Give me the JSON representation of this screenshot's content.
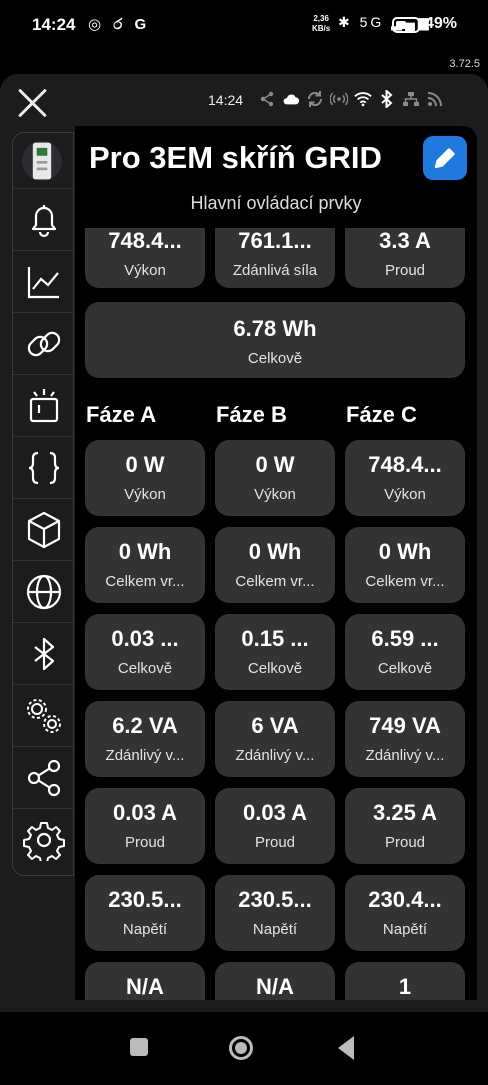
{
  "status_bar": {
    "time": "14:24",
    "left_icons": "◎ ර G",
    "net_speed_value": "2,36",
    "net_speed_unit": "KB/s",
    "right_icons": "✱ 5G ▂▄▆",
    "battery": "49%"
  },
  "version": "3.72.5",
  "toolbar": {
    "time": "14:24",
    "icons": [
      "share-icon",
      "cloud-icon",
      "sync-icon",
      "wifi-ap-icon",
      "wifi-icon",
      "bluetooth-icon",
      "ethernet-icon",
      "rss-icon"
    ]
  },
  "sidebar": {
    "items": [
      "device-icon",
      "bell-icon",
      "chart-icon",
      "link-icon",
      "actions-icon",
      "scripts-icon",
      "package-icon",
      "globe-icon",
      "bluetooth-icon",
      "settings-multiple-icon",
      "share-icon",
      "settings-icon"
    ]
  },
  "device": {
    "title": "Pro 3EM skříň GRID",
    "subtitle": "Hlavní ovládací prvky"
  },
  "summary": [
    {
      "value": "748.4...",
      "label": "Výkon"
    },
    {
      "value": "761.1...",
      "label": "Zdánlivá síla"
    },
    {
      "value": "3.3 A",
      "label": "Proud"
    }
  ],
  "total": {
    "value": "6.78 Wh",
    "label": "Celkově"
  },
  "phase_headers": [
    "Fáze A",
    "Fáze B",
    "Fáze C"
  ],
  "phase_rows": [
    [
      {
        "value": "0 W",
        "label": "Výkon"
      },
      {
        "value": "0 W",
        "label": "Výkon"
      },
      {
        "value": "748.4...",
        "label": "Výkon"
      }
    ],
    [
      {
        "value": "0 Wh",
        "label": "Celkem vr..."
      },
      {
        "value": "0 Wh",
        "label": "Celkem vr..."
      },
      {
        "value": "0 Wh",
        "label": "Celkem vr..."
      }
    ],
    [
      {
        "value": "0.03 ...",
        "label": "Celkově"
      },
      {
        "value": "0.15 ...",
        "label": "Celkově"
      },
      {
        "value": "6.59 ...",
        "label": "Celkově"
      }
    ],
    [
      {
        "value": "6.2 VA",
        "label": "Zdánlivý v..."
      },
      {
        "value": "6 VA",
        "label": "Zdánlivý v..."
      },
      {
        "value": "749 VA",
        "label": "Zdánlivý v..."
      }
    ],
    [
      {
        "value": "0.03 A",
        "label": "Proud"
      },
      {
        "value": "0.03 A",
        "label": "Proud"
      },
      {
        "value": "3.25 A",
        "label": "Proud"
      }
    ],
    [
      {
        "value": "230.5...",
        "label": "Napětí"
      },
      {
        "value": "230.5...",
        "label": "Napětí"
      },
      {
        "value": "230.4...",
        "label": "Napětí"
      }
    ],
    [
      {
        "value": "N/A",
        "label": ""
      },
      {
        "value": "N/A",
        "label": ""
      },
      {
        "value": "1",
        "label": ""
      }
    ]
  ]
}
